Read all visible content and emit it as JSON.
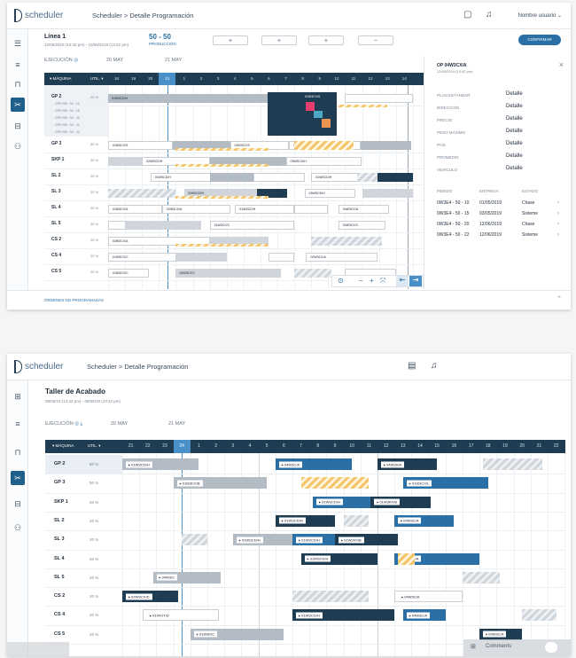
{
  "screen1": {
    "logo_text": "scheduler",
    "breadcrumb": "Scheduler > Detalle Programación",
    "user_label": "Nombre usuario",
    "line_title": "Línea 1",
    "line_subtitle": "12/05/2019 (13:42 pm) - 10/06/2019 (13:42 pm)",
    "kpi_value": "50 - 50",
    "kpi_label": "PRODUCCIÓN",
    "stepper_labels": [
      "+",
      "+",
      "+",
      "−"
    ],
    "action_button": "CONFIRMAR",
    "exec_label": "EJECUCIÓN",
    "date_labels": [
      "20 MAY",
      "21 MAY"
    ],
    "col_machine": "MÁQUINA",
    "col_util": "UTIL.",
    "days": [
      "18",
      "19",
      "20",
      "21",
      "1",
      "2",
      "3",
      "4",
      "5",
      "6",
      "7",
      "8",
      "9",
      "10",
      "11",
      "12",
      "13",
      "14"
    ],
    "today_index": 3,
    "rows": [
      {
        "name": "GP 2",
        "util": "20 %",
        "subs": [
          "GPFO05 - 50 - 10",
          "GPFO05 - 50 - 15",
          "GPFO05 - 50 - 20",
          "GPFO05 - 50 - 21",
          "GPFO05 - 50 - 22"
        ]
      },
      {
        "name": "GP 3",
        "util": "50 %"
      },
      {
        "name": "SKP 1",
        "util": "20 %"
      },
      {
        "name": "SL 2",
        "util": "20 %"
      },
      {
        "name": "SL 3",
        "util": "20 %"
      },
      {
        "name": "SL 4",
        "util": "20 %"
      },
      {
        "name": "SL 5",
        "util": "20 %"
      },
      {
        "name": "CS 2",
        "util": "20 %"
      },
      {
        "name": "CS 4",
        "util": "20 %"
      },
      {
        "name": "CS 5",
        "util": "20 %"
      }
    ],
    "bar_labels": [
      "01WSCD/H",
      "01W3CX/S",
      "02W3CX/S",
      "01W3CX/S",
      "01WSCD/H",
      "02WSCD/H",
      "03WSCD/H",
      "01WSCD/H",
      "04W3CX/A",
      "01WSCD/H",
      "02WSCD/H",
      "03WSCD/H",
      "01W3CX/A",
      "02W3CX/A",
      "01WSCD/H",
      "04W3CX/A",
      "01W3CX/C",
      "02W3CX/C",
      "03W3CX/A",
      "01W3CX/C",
      "02W3CX/A",
      "01W3CX/C",
      "04W3CX/C"
    ],
    "panel": {
      "title": "OP 04W3CX/A",
      "subtitle": "12/05/2019 (13:42 pm)",
      "fields": [
        {
          "label": "PLAN ESTÁNDAR",
          "value": "Detalle"
        },
        {
          "label": "DIRECCIÓN",
          "value": "Detalle"
        },
        {
          "label": "PRECIO",
          "value": "Detalle"
        },
        {
          "label": "PESO MÁXIMO",
          "value": "Detalle"
        },
        {
          "label": "PAÍS",
          "value": "Detalle"
        },
        {
          "label": "PROMEDIO",
          "value": "Detalle"
        },
        {
          "label": "VEHÍCULO",
          "value": "Detalle"
        }
      ],
      "table_headers": [
        "PEDIDO",
        "ENTREGA",
        "ESTADO"
      ],
      "table_rows": [
        [
          "0W3E4 - 50 - 10",
          "01/05/2019",
          "Chase"
        ],
        [
          "0W3E4 - 50 - 15",
          "03/05/2019",
          "Sisteme"
        ],
        [
          "0W3E4 - 50 - 20",
          "12/06/2019",
          "Chase"
        ],
        [
          "0W3E4 - 50 - 22",
          "12/06/2019",
          "Sisteme"
        ]
      ]
    },
    "footer": "ÓRDENES NO PROGRAMADAS"
  },
  "screen2": {
    "logo_text": "scheduler",
    "breadcrumb": "Scheduler > Detalle Programación",
    "title": "Taller de Acabado",
    "subtitle": "08/06/19 (13:42 pm) - 08/06/19 (13:42 pm)",
    "exec_label": "EJECUCIÓN",
    "date_labels": [
      "20 MAY",
      "21 MAY"
    ],
    "col_machine": "MÁQUINA",
    "col_util": "UTIL.",
    "days": [
      "21",
      "22",
      "23",
      "24",
      "1",
      "2",
      "3",
      "4",
      "5",
      "6",
      "7",
      "8",
      "9",
      "10",
      "11",
      "12",
      "13",
      "14",
      "15",
      "16",
      "17",
      "18",
      "19",
      "20",
      "21",
      "22"
    ],
    "today_index": 3,
    "rows": [
      {
        "name": "GP 2",
        "util": "80 %"
      },
      {
        "name": "GP 3",
        "util": "50 %"
      },
      {
        "name": "SKP 1",
        "util": "20 %"
      },
      {
        "name": "SL 2",
        "util": "20 %"
      },
      {
        "name": "SL 3",
        "util": "20 %"
      },
      {
        "name": "SL 4",
        "util": "20 %"
      },
      {
        "name": "SL 5",
        "util": "20 %"
      },
      {
        "name": "CS 2",
        "util": "20 %"
      },
      {
        "name": "CS 4",
        "util": "20 %"
      },
      {
        "name": "CS 5",
        "util": "20 %"
      }
    ],
    "bar_labels": [
      "01WSCD/H",
      "04W3C/A",
      "04W3H/A",
      "01W3CX/B",
      "01W3CX/L",
      "01WSCD/H",
      "01W3KX/B",
      "01WSCD/H",
      "04W3C/A",
      "01WSCD/H",
      "01WSCD/H",
      "01W2KX/B",
      "01WSCD/H",
      "04W3C/A",
      "04W3/C",
      "02WSCX/D",
      "04W3C/A",
      "01VRJT/D",
      "01WSCD/H",
      "04W3C/A",
      "01W3K/C",
      "04W3C/A"
    ],
    "comments_label": "Comments"
  }
}
